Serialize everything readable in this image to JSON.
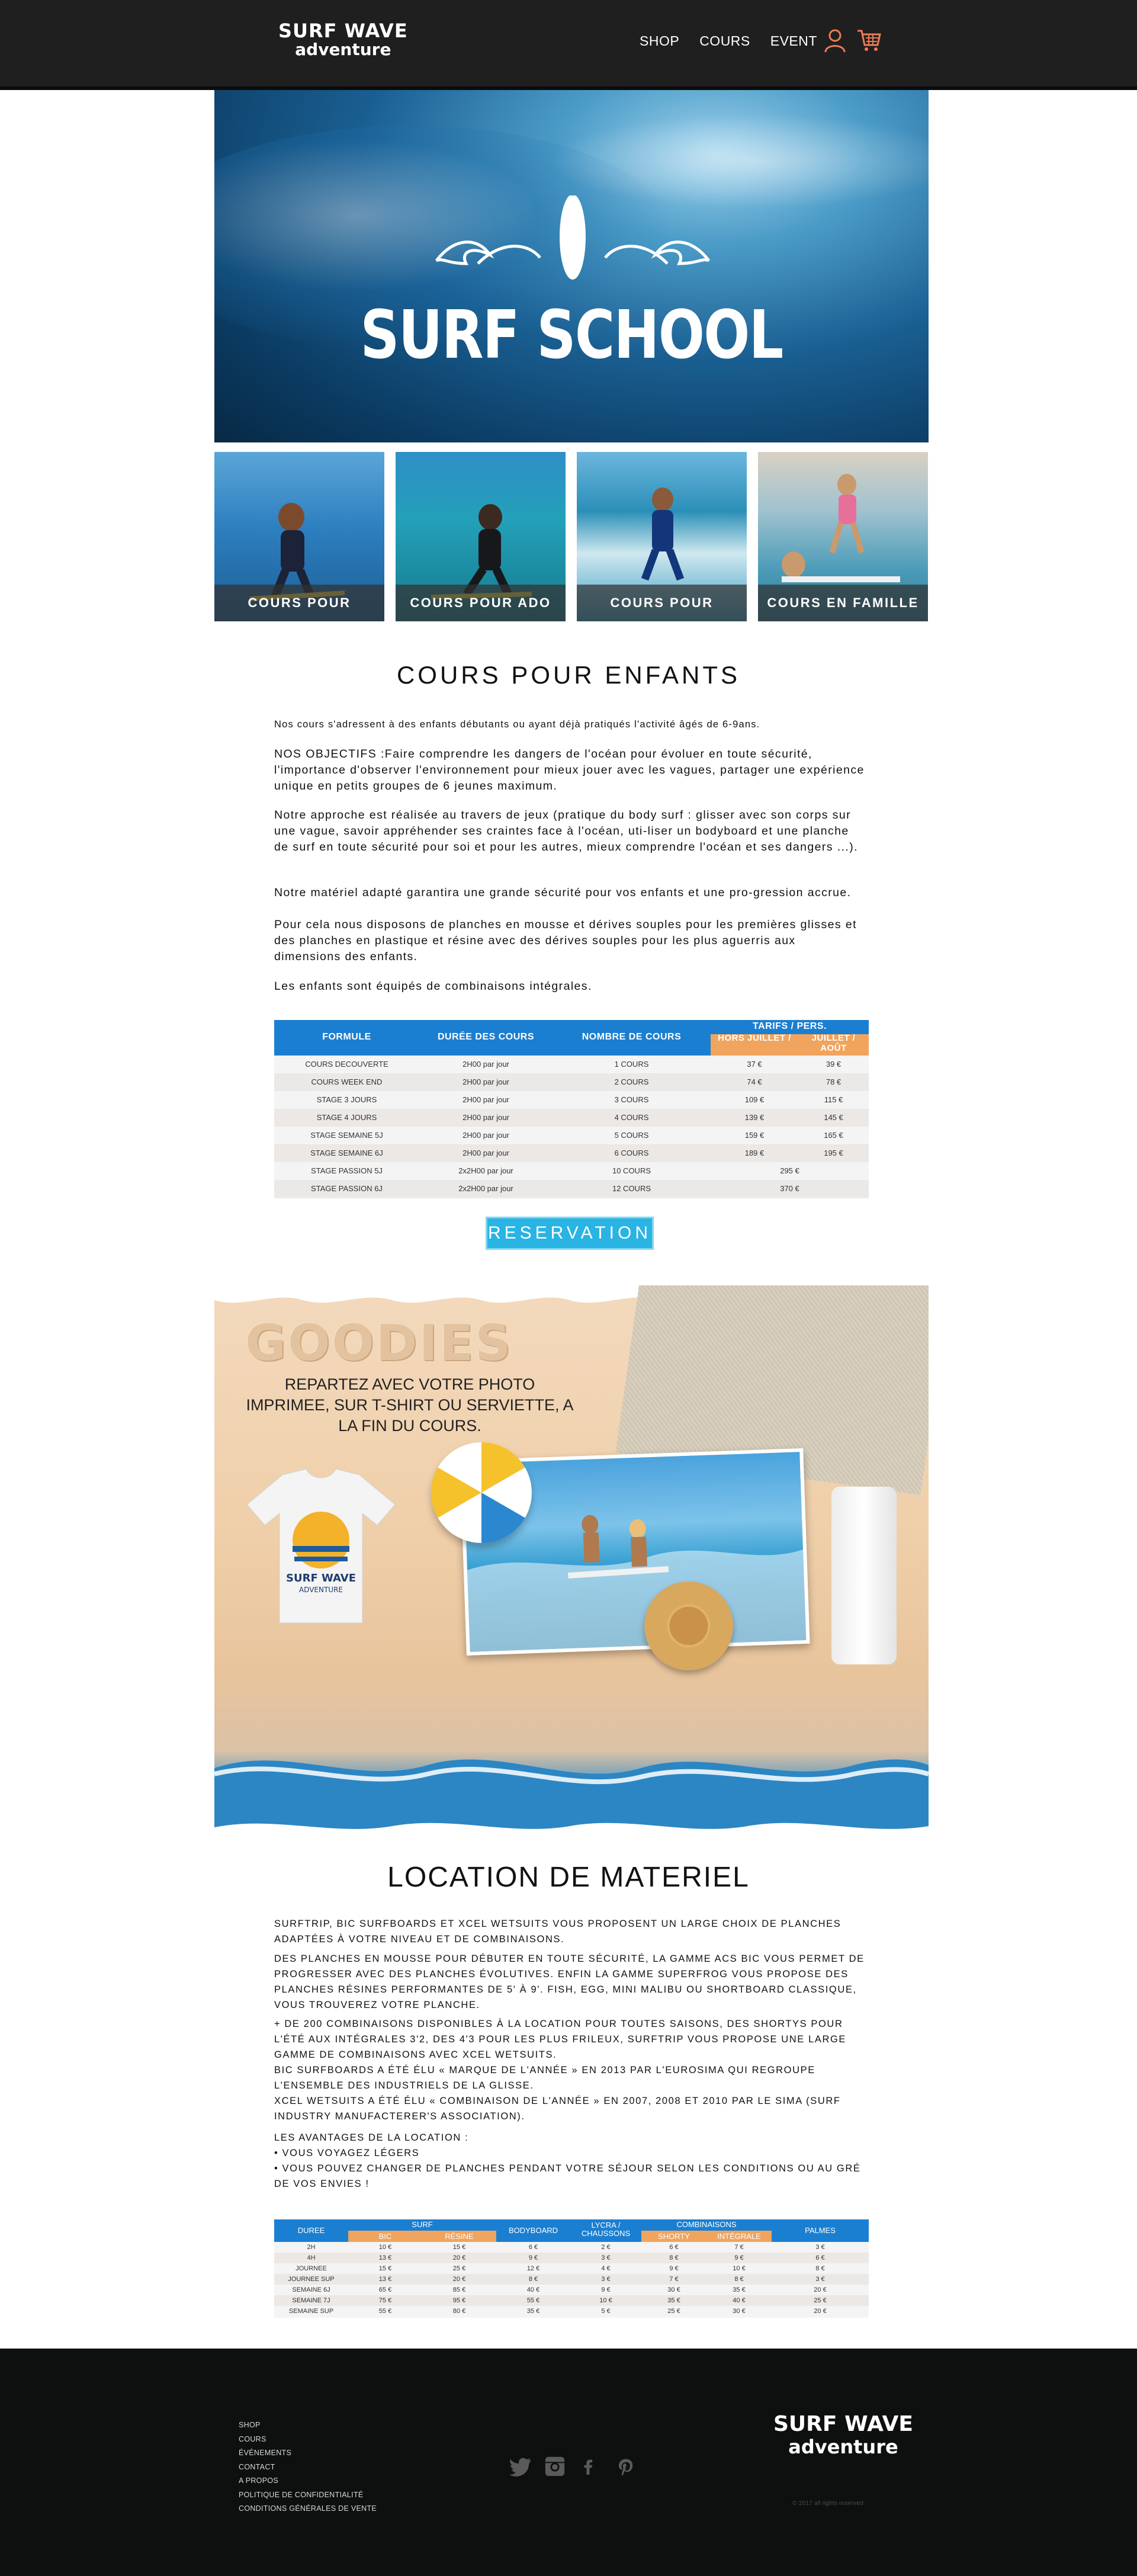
{
  "header": {
    "logo_line1": "SURF WAVE",
    "logo_line2": "adventure",
    "nav": [
      "SHOP",
      "COURS",
      "EVENT"
    ],
    "icons": [
      "user-icon",
      "cart-icon"
    ],
    "accent": "#ef7b55"
  },
  "hero": {
    "title": "SURF SCHOOL"
  },
  "cards": [
    {
      "label": "COURS POUR ENFANTS"
    },
    {
      "label": "COURS POUR ADO"
    },
    {
      "label": "COURS POUR ADULTES"
    },
    {
      "label": "COURS EN FAMILLE"
    }
  ],
  "cours": {
    "title": "COURS POUR ENFANTS",
    "intro": "Nos cours s'adressent à des enfants débutants ou ayant déjà pratiqués l'activité âgés de 6-9ans.",
    "p1": "NOS OBJECTIFS :Faire comprendre les dangers de l'océan pour évoluer en toute sécurité, l'importance d'observer l'environnement pour mieux jouer avec les vagues, partager une expérience unique en petits groupes de 6 jeunes maximum.",
    "p2": "Notre approche est réalisée au travers de jeux (pratique du body surf : glisser avec son corps sur une vague, savoir appréhender ses craintes face à l'océan, uti-liser un bodyboard et une planche de surf en toute sécurité pour soi et pour les autres, mieux comprendre l'océan et ses dangers ...).",
    "p3": "Notre matériel adapté garantira une grande sécurité pour vos enfants et une pro-gression accrue.",
    "p4": "Pour cela nous disposons de planches en mousse et dérives souples pour les premières glisses et des planches en plastique et résine avec des dérives souples pour les plus aguerris aux dimensions des enfants.",
    "p5": "Les enfants sont équipés de combinaisons intégrales."
  },
  "table1": {
    "headers": {
      "formule": "FORMULE",
      "duree": "DURÉE DES COURS",
      "nombre": "NOMBRE DE COURS",
      "tarifs": "TARIFS / PERS.",
      "hors": "HORS JUILLET /",
      "juillet": "JUILLET / AOÛT"
    },
    "rows": [
      [
        "COURS DECOUVERTE",
        "2H00 par jour",
        "1 COURS",
        "37 €",
        "39 €"
      ],
      [
        "COURS WEEK END",
        "2H00 par jour",
        "2 COURS",
        "74 €",
        "78 €"
      ],
      [
        "STAGE 3 JOURS",
        "2H00 par jour",
        "3 COURS",
        "109 €",
        "115 €"
      ],
      [
        "STAGE 4 JOURS",
        "2H00 par jour",
        "4 COURS",
        "139 €",
        "145 €"
      ],
      [
        "STAGE SEMAINE 5J",
        "2H00 par jour",
        "5 COURS",
        "159 €",
        "165 €"
      ],
      [
        "STAGE SEMAINE 6J",
        "2H00 par jour",
        "6 COURS",
        "189 €",
        "195 €"
      ],
      [
        "STAGE PASSION 5J",
        "2x2H00 par jour",
        "10 COURS",
        "295 €",
        ""
      ],
      [
        "STAGE PASSION 6J",
        "2x2H00 par jour",
        "12 COURS",
        "370 €",
        ""
      ]
    ]
  },
  "reservation_label": "RESERVATION",
  "goodies": {
    "title": "GOODIES",
    "subtitle": "REPARTEZ AVEC VOTRE PHOTO IMPRIMEE, SUR T-SHIRT OU SERVIETTE, A LA FIN DU COURS.",
    "tshirt_line1": "SURF WAVE",
    "tshirt_line2": "ADVENTURE"
  },
  "location": {
    "title": "LOCATION DE MATERIEL",
    "p1": "Surftrip, BIC Surfboards et XCEL Wetsuits vous proposent un large choix de planches adaptées à votre niveau et de combinaisons.",
    "p2": "Des planches en mousse pour débuter en toute sécurité, la gamme ACS BIC vous permet de progresser avec des planches évolutives. Enfin la gamme Superfrog vous propose des planches résines performantes de 5' à 9'. Fish, egg, mini malibu ou shortboard classique, vous trouverez votre planche.",
    "p3": "+ de 200 combinaisons disponibles à la location pour toutes saisons, des shortys pour l'été aux intégrales 3'2, des 4'3 pour les plus frileux, Surftrip vous propose une large gamme de combinaisons avec XCEL Wetsuits.",
    "p4": "BIC Surfboards a été élu « Marque de l'année » en 2013 par l'Eurosima qui regroupe l'ensemble des industriels de la glisse.",
    "p5": "XCEL Wetsuits a été élu « Combinaison de l'année » en 2007, 2008 et 2010 par le SIMA (Surf Industry Manufacterer's Association).",
    "avantages": "Les avantages de la location :",
    "b1": "•    Vous voyagez légers",
    "b2": "•    Vous pouvez changer de planches pendant votre séjour selon les conditions ou au gré de vos envies !"
  },
  "table2": {
    "headers": {
      "duree": "DUREE",
      "surf": "SURF",
      "bic": "BIC",
      "resine": "RÉSINE",
      "bodyboard": "BODYBOARD",
      "lycra": "LYCRA / CHAUSSONS",
      "combinaisons": "COMBINAISONS",
      "shorty": "SHORTY",
      "integrale": "INTÉGRALE",
      "palmes": "PALMES"
    },
    "rows": [
      [
        "2H",
        "10 €",
        "15 €",
        "6 €",
        "2 €",
        "6 €",
        "7 €",
        "3 €"
      ],
      [
        "4H",
        "13 €",
        "20 €",
        "9 €",
        "3 €",
        "8 €",
        "9 €",
        "6 €"
      ],
      [
        "JOURNEE",
        "15 €",
        "25 €",
        "12 €",
        "4 €",
        "9 €",
        "10 €",
        "8 €"
      ],
      [
        "JOURNEE SUP",
        "13 €",
        "20 €",
        "8 €",
        "3 €",
        "7 €",
        "8 €",
        "3 €"
      ],
      [
        "SEMAINE 6J",
        "65 €",
        "85 €",
        "40 €",
        "9 €",
        "30 €",
        "35 €",
        "20 €"
      ],
      [
        "SEMAINE 7J",
        "75 €",
        "95 €",
        "55 €",
        "10 €",
        "35 €",
        "40 €",
        "25 €"
      ],
      [
        "SEMAINE SUP",
        "55 €",
        "80 €",
        "35 €",
        "5 €",
        "25 €",
        "30 €",
        "20 €"
      ]
    ]
  },
  "footer": {
    "links": [
      "SHOP",
      "COURS",
      "ÉVÉNEMENTS",
      "CONTACT",
      "A PROPOS",
      "POLITIQUE DE CONFIDENTIALITÉ",
      "CONDITIONS GÉNÉRALES DE VENTE"
    ],
    "social": [
      "twitter-icon",
      "instagram-icon",
      "facebook-icon",
      "pinterest-icon"
    ],
    "logo_line1": "SURF WAVE",
    "logo_line2": "adventure",
    "copyright": "© 2017 all rights reserved"
  }
}
